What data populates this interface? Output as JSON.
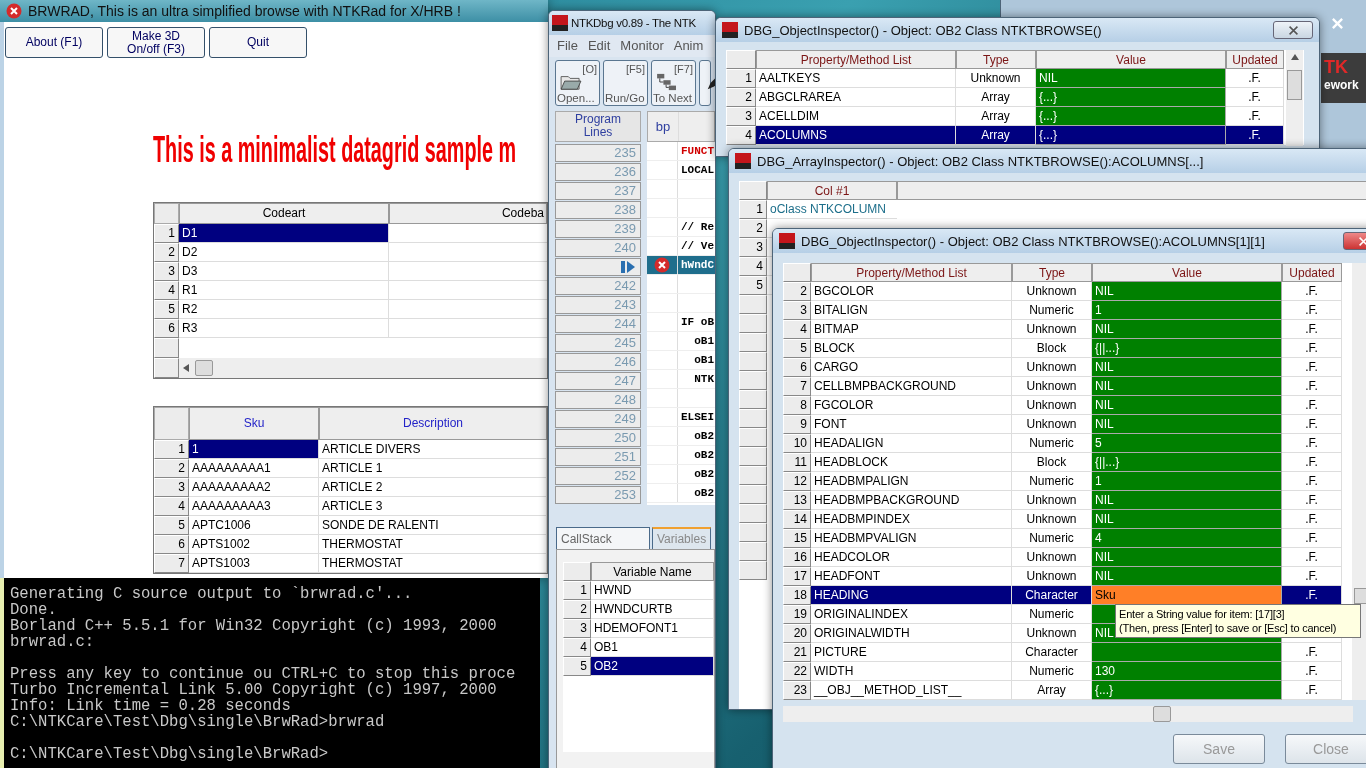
{
  "background_window": {
    "logo_lines": [
      "TK",
      "ework"
    ]
  },
  "console": {
    "blocks": [
      [
        "Generating C source output to `brwrad.c'...",
        "Done.",
        "Borland C++ 5.5.1 for Win32 Copyright (c) 1993, 2000",
        "brwrad.c:"
      ],
      [
        "Press any key to continue ou CTRL+C to stop this proce",
        "Turbo Incremental Link 5.00 Copyright (c) 1997, 2000",
        "Info: Link time = 0.28 seconds",
        "C:\\NTKCare\\Test\\Dbg\\single\\BrwRad>brwrad"
      ],
      [
        "C:\\NTKCare\\Test\\Dbg\\single\\BrwRad>"
      ]
    ]
  },
  "brwrad": {
    "title": "BRWRAD, This is an ultra simplified browse with NTKRad for X/HRB !",
    "buttons": [
      [
        "About (F1)"
      ],
      [
        "Make 3D",
        "On/off (F3)"
      ],
      [
        "Quit"
      ]
    ],
    "headline": "This is a minimalist datagrid sample m",
    "grid_1": {
      "columns": [
        "Codeart",
        "Codeba"
      ],
      "rows": [
        {
          "number": "1",
          "codeart": "D1",
          "selected": true
        },
        {
          "number": "2",
          "codeart": "D2",
          "selected": false
        },
        {
          "number": "3",
          "codeart": "D3",
          "selected": false
        },
        {
          "number": "4",
          "codeart": "R1",
          "selected": false
        },
        {
          "number": "5",
          "codeart": "R2",
          "selected": false
        },
        {
          "number": "6",
          "codeart": "R3",
          "selected": false
        }
      ]
    },
    "grid_2": {
      "columns": [
        "Sku",
        "Description"
      ],
      "rows": [
        {
          "number": "1",
          "sku": "1",
          "description": "ARTICLE DIVERS",
          "selected": true
        },
        {
          "number": "2",
          "sku": "AAAAAAAAA1",
          "description": "ARTICLE 1",
          "selected": false
        },
        {
          "number": "3",
          "sku": "AAAAAAAAA2",
          "description": "ARTICLE 2",
          "selected": false
        },
        {
          "number": "4",
          "sku": "AAAAAAAAA3",
          "description": "ARTICLE 3",
          "selected": false
        },
        {
          "number": "5",
          "sku": "APTC1006",
          "description": "SONDE DE RALENTI",
          "selected": false
        },
        {
          "number": "6",
          "sku": "APTS1002",
          "description": "THERMOSTAT",
          "selected": false
        },
        {
          "number": "7",
          "sku": "APTS1003",
          "description": "THERMOSTAT",
          "selected": false
        }
      ]
    }
  },
  "debugger": {
    "title": "NTKDbg v0.89 - The NTK",
    "menu": [
      "File",
      "Edit",
      "Monitor",
      "Anim"
    ],
    "toolbar": [
      {
        "key": "[O]",
        "label": "Open...",
        "kind": "folder"
      },
      {
        "key": "[F5]",
        "label": "Run/Go",
        "kind": "plain"
      },
      {
        "key": "[F7]",
        "label": "To Next",
        "kind": "steps"
      },
      {
        "kind": "pen"
      }
    ],
    "lines_header": [
      "Program",
      "Lines"
    ],
    "bp_header": "bp",
    "lines": [
      {
        "number": "235",
        "code": "FUNCT",
        "color": "#d00000",
        "current": false,
        "breakpoint": false
      },
      {
        "number": "236",
        "code": "LOCAL",
        "color": "#000000",
        "current": false,
        "breakpoint": false
      },
      {
        "number": "237",
        "current": false,
        "breakpoint": false
      },
      {
        "number": "238",
        "current": false,
        "breakpoint": false
      },
      {
        "number": "239",
        "code": "// Re",
        "color": "#000000",
        "current": false,
        "breakpoint": false
      },
      {
        "number": "240",
        "code": "// Ve",
        "color": "#000000",
        "current": false,
        "breakpoint": false
      },
      {
        "code": "hWndC",
        "current": true,
        "breakpoint": true
      },
      {
        "number": "242",
        "current": false,
        "breakpoint": false
      },
      {
        "number": "243",
        "current": false,
        "breakpoint": false
      },
      {
        "number": "244",
        "code": "IF oB",
        "color": "#000000",
        "current": false,
        "breakpoint": false
      },
      {
        "number": "245",
        "code": "  oB1",
        "color": "#000000",
        "current": false,
        "breakpoint": false
      },
      {
        "number": "246",
        "code": "  oB1",
        "color": "#000000",
        "current": false,
        "breakpoint": false
      },
      {
        "number": "247",
        "code": "  NTK",
        "color": "#000000",
        "current": false,
        "breakpoint": false
      },
      {
        "number": "248",
        "current": false,
        "breakpoint": false
      },
      {
        "number": "249",
        "code": "ELSEI",
        "color": "#000000",
        "current": false,
        "breakpoint": false
      },
      {
        "number": "250",
        "code": "  oB2",
        "color": "#000000",
        "current": false,
        "breakpoint": false
      },
      {
        "number": "251",
        "code": "  oB2",
        "color": "#000000",
        "current": false,
        "breakpoint": false
      },
      {
        "number": "252",
        "code": "  oB2",
        "color": "#000000",
        "current": false,
        "breakpoint": false
      },
      {
        "number": "253",
        "code": "  oB2",
        "color": "#000000",
        "current": false,
        "breakpoint": false
      }
    ],
    "tabs": [
      {
        "label": "CallStack",
        "selected": false
      },
      {
        "label": "Variables",
        "selected": true
      }
    ],
    "variables": {
      "column": "Variable Name",
      "rows": [
        {
          "number": "1",
          "name": "HWND",
          "selected": false
        },
        {
          "number": "2",
          "name": "HWNDCURTB",
          "selected": false
        },
        {
          "number": "3",
          "name": "HDEMOFONT1",
          "selected": false
        },
        {
          "number": "4",
          "name": "OB1",
          "selected": false
        },
        {
          "number": "5",
          "name": "OB2",
          "selected": true
        }
      ]
    }
  },
  "inspector_1": {
    "title": "DBG_ObjectInspector() - Object: OB2 Class NTKTBROWSE()",
    "columns": [
      "Property/Method List",
      "Type",
      "Value",
      "Updated"
    ],
    "rows": [
      {
        "number": "1",
        "property": "AALTKEYS",
        "type": "Unknown",
        "value": "NIL",
        "updated": ".F.",
        "selected": false
      },
      {
        "number": "2",
        "property": "ABGCLRAREA",
        "type": "Array",
        "value": "{...}",
        "updated": ".F.",
        "selected": false
      },
      {
        "number": "3",
        "property": "ACELLDIM",
        "type": "Array",
        "value": "{...}",
        "updated": ".F.",
        "selected": false
      },
      {
        "number": "4",
        "property": "ACOLUMNS",
        "type": "Array",
        "value": "{...}",
        "updated": ".F.",
        "selected": true
      }
    ]
  },
  "array_inspector": {
    "title": "DBG_ArrayInspector() - Object: OB2 Class NTKTBROWSE():ACOLUMNS[...]",
    "columns": [
      "Col #1"
    ],
    "rows": [
      {
        "number": "1",
        "value": "oClass NTKCOLUMN"
      },
      {
        "number": "2"
      },
      {
        "number": "3"
      },
      {
        "number": "4"
      },
      {
        "number": "5"
      }
    ]
  },
  "inspector_2": {
    "title": "DBG_ObjectInspector() - Object: OB2 Class NTKTBROWSE():ACOLUMNS[1][1]",
    "columns": [
      "Property/Method List",
      "Type",
      "Value",
      "Updated"
    ],
    "rows": [
      {
        "number": "2",
        "property": "BGCOLOR",
        "type": "Unknown",
        "value": "NIL",
        "updated": ".F.",
        "selected": false,
        "editing": false
      },
      {
        "number": "3",
        "property": "BITALIGN",
        "type": "Numeric",
        "value": "1",
        "updated": ".F.",
        "selected": false,
        "editing": false
      },
      {
        "number": "4",
        "property": "BITMAP",
        "type": "Unknown",
        "value": "NIL",
        "updated": ".F.",
        "selected": false,
        "editing": false
      },
      {
        "number": "5",
        "property": "BLOCK",
        "type": "Block",
        "value": "{||...}",
        "updated": ".F.",
        "selected": false,
        "editing": false
      },
      {
        "number": "6",
        "property": "CARGO",
        "type": "Unknown",
        "value": "NIL",
        "updated": ".F.",
        "selected": false,
        "editing": false
      },
      {
        "number": "7",
        "property": "CELLBMPBACKGROUND",
        "type": "Unknown",
        "value": "NIL",
        "updated": ".F.",
        "selected": false,
        "editing": false
      },
      {
        "number": "8",
        "property": "FGCOLOR",
        "type": "Unknown",
        "value": "NIL",
        "updated": ".F.",
        "selected": false,
        "editing": false
      },
      {
        "number": "9",
        "property": "FONT",
        "type": "Unknown",
        "value": "NIL",
        "updated": ".F.",
        "selected": false,
        "editing": false
      },
      {
        "number": "10",
        "property": "HEADALIGN",
        "type": "Numeric",
        "value": "5",
        "updated": ".F.",
        "selected": false,
        "editing": false
      },
      {
        "number": "11",
        "property": "HEADBLOCK",
        "type": "Block",
        "value": "{||...}",
        "updated": ".F.",
        "selected": false,
        "editing": false
      },
      {
        "number": "12",
        "property": "HEADBMPALIGN",
        "type": "Numeric",
        "value": "1",
        "updated": ".F.",
        "selected": false,
        "editing": false
      },
      {
        "number": "13",
        "property": "HEADBMPBACKGROUND",
        "type": "Unknown",
        "value": "NIL",
        "updated": ".F.",
        "selected": false,
        "editing": false
      },
      {
        "number": "14",
        "property": "HEADBMPINDEX",
        "type": "Unknown",
        "value": "NIL",
        "updated": ".F.",
        "selected": false,
        "editing": false
      },
      {
        "number": "15",
        "property": "HEADBMPVALIGN",
        "type": "Numeric",
        "value": "4",
        "updated": ".F.",
        "selected": false,
        "editing": false
      },
      {
        "number": "16",
        "property": "HEADCOLOR",
        "type": "Unknown",
        "value": "NIL",
        "updated": ".F.",
        "selected": false,
        "editing": false
      },
      {
        "number": "17",
        "property": "HEADFONT",
        "type": "Unknown",
        "value": "NIL",
        "updated": ".F.",
        "selected": false,
        "editing": false
      },
      {
        "number": "18",
        "property": "HEADING",
        "type": "Character",
        "value": "Sku",
        "updated": ".F.",
        "selected": true,
        "editing": true
      },
      {
        "number": "19",
        "property": "ORIGINALINDEX",
        "type": "Numeric",
        "selected": false,
        "editing": false
      },
      {
        "number": "20",
        "property": "ORIGINALWIDTH",
        "type": "Unknown",
        "value": "NIL",
        "selected": false,
        "editing": false
      },
      {
        "number": "21",
        "property": "PICTURE",
        "type": "Character",
        "updated": ".F.",
        "selected": false,
        "editing": false
      },
      {
        "number": "22",
        "property": "WIDTH",
        "type": "Numeric",
        "value": "130",
        "updated": ".F.",
        "selected": false,
        "editing": false
      },
      {
        "number": "23",
        "property": "__OBJ__METHOD_LIST__",
        "type": "Array",
        "value": "{...}",
        "updated": ".F.",
        "selected": false,
        "editing": false
      }
    ],
    "tooltip": [
      "Enter a String value for item: [17][3]",
      "(Then, press [Enter] to save or [Esc] to cancel)"
    ],
    "buttons": [
      "Save",
      "Close"
    ]
  }
}
